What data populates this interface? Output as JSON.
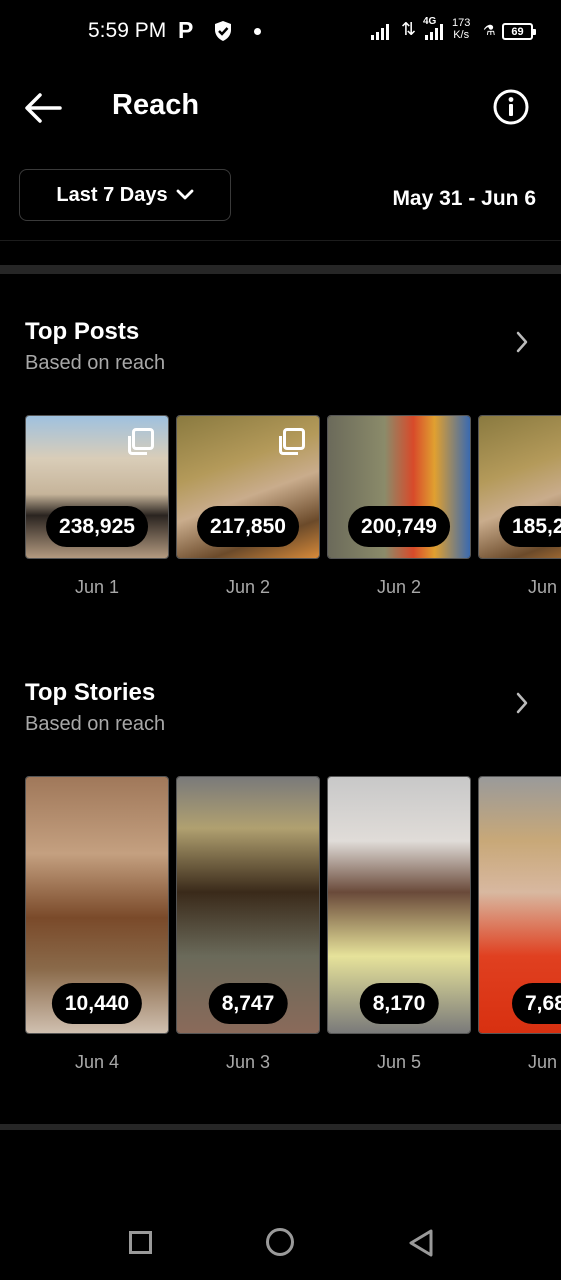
{
  "status_bar": {
    "time": "5:59 PM",
    "p_icon": "P",
    "network_type": "4G",
    "speed_value": "173",
    "speed_unit": "K/s",
    "battery": "69"
  },
  "header": {
    "title": "Reach",
    "back_icon": "arrow-left-icon",
    "info_icon": "info-icon"
  },
  "filter": {
    "label": "Last 7 Days",
    "date_range": "May 31 - Jun 6"
  },
  "top_posts": {
    "title": "Top Posts",
    "subtitle": "Based on reach",
    "items": [
      {
        "value": "238,925",
        "date": "Jun 1",
        "multi": true
      },
      {
        "value": "217,850",
        "date": "Jun 2",
        "multi": true
      },
      {
        "value": "200,749",
        "date": "Jun 2",
        "multi": false
      },
      {
        "value": "185,2",
        "date": "Jun",
        "multi": false
      }
    ]
  },
  "top_stories": {
    "title": "Top Stories",
    "subtitle": "Based on reach",
    "items": [
      {
        "value": "10,440",
        "date": "Jun 4"
      },
      {
        "value": "8,747",
        "date": "Jun 3"
      },
      {
        "value": "8,170",
        "date": "Jun 5"
      },
      {
        "value": "7,68",
        "date": "Jun"
      }
    ]
  },
  "colors": {
    "background": "#000000",
    "secondary_text": "#a8a8a8",
    "divider": "#262626"
  }
}
